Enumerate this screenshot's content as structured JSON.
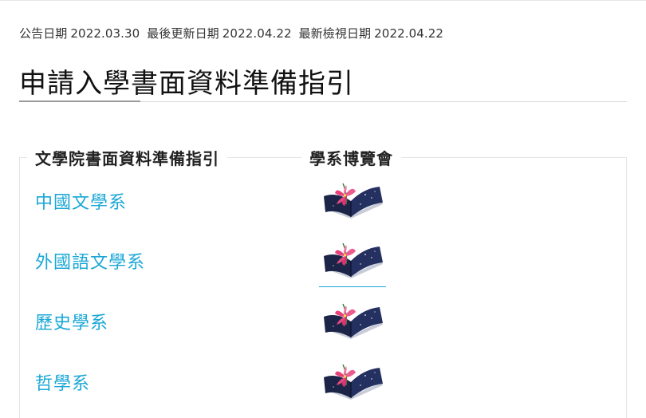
{
  "meta": {
    "announce_label": "公告日期",
    "announce_date": "2022.03.30",
    "updated_label": "最後更新日期",
    "updated_date": "2022.04.22",
    "viewed_label": "最新檢視日期",
    "viewed_date": "2022.04.22"
  },
  "title": "申請入學書面資料準備指引",
  "table": {
    "headers": [
      "文學院書面資料準備指引",
      "學系博覽會"
    ],
    "rows": [
      {
        "department": "中國文學系",
        "expo_icon": "book-lily-icon"
      },
      {
        "department": "外國語文學系",
        "expo_icon": "book-lily-icon"
      },
      {
        "department": "歷史學系",
        "expo_icon": "book-lily-icon"
      },
      {
        "department": "哲學系",
        "expo_icon": "book-lily-icon"
      }
    ]
  },
  "colors": {
    "link": "#1aa7d6",
    "book": "#1c2548",
    "lily": "#e8407a"
  }
}
